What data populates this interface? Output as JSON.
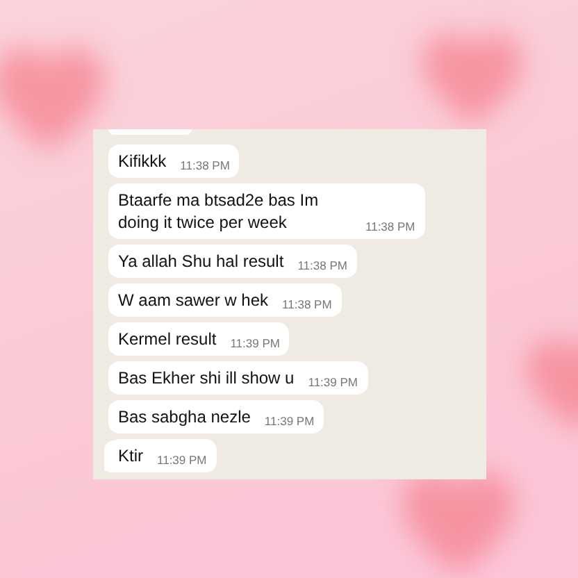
{
  "messages": [
    {
      "text": "Kifikkk",
      "time": "11:38 PM",
      "tail": false
    },
    {
      "text": "Btaarfe ma btsad2e bas Im doing it twice per week",
      "time": "11:38 PM",
      "tail": false
    },
    {
      "text": "Ya allah Shu hal result",
      "time": "11:38 PM",
      "tail": false
    },
    {
      "text": "W aam sawer w hek",
      "time": "11:38 PM",
      "tail": false
    },
    {
      "text": "Kermel result",
      "time": "11:39 PM",
      "tail": false
    },
    {
      "text": "Bas Ekher shi ill show u",
      "time": "11:39 PM",
      "tail": false
    },
    {
      "text": "Bas sabgha nezle",
      "time": "11:39 PM",
      "tail": false
    },
    {
      "text": "Ktir",
      "time": "11:39 PM",
      "tail": true
    }
  ]
}
